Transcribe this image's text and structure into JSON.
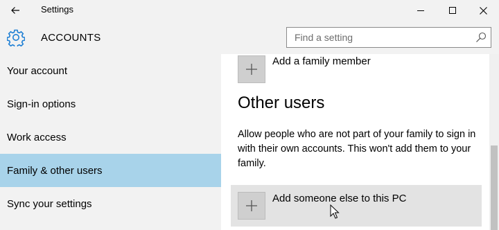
{
  "window": {
    "title": "Settings",
    "back_icon": "back-arrow-icon",
    "minimize_icon": "minimize-icon",
    "maximize_icon": "maximize-icon",
    "close_icon": "close-icon"
  },
  "header": {
    "icon": "gear-icon",
    "section_title": "ACCOUNTS",
    "search": {
      "placeholder": "Find a setting",
      "value": "",
      "icon": "search-icon"
    }
  },
  "sidebar": {
    "selected_color": "#a8d3ea",
    "items": [
      {
        "label": "Your account",
        "selected": false
      },
      {
        "label": "Sign-in options",
        "selected": false
      },
      {
        "label": "Work access",
        "selected": false
      },
      {
        "label": "Family & other users",
        "selected": true
      },
      {
        "label": "Sync your settings",
        "selected": false
      }
    ]
  },
  "main": {
    "add_family_member": {
      "label": "Add a family member",
      "icon": "plus-icon"
    },
    "other_users": {
      "heading": "Other users",
      "description": "Allow people who are not part of your family to sign in with their own accounts. This won't add them to your family."
    },
    "add_someone_else": {
      "label": "Add someone else to this PC",
      "icon": "plus-icon",
      "hovered": true
    }
  }
}
